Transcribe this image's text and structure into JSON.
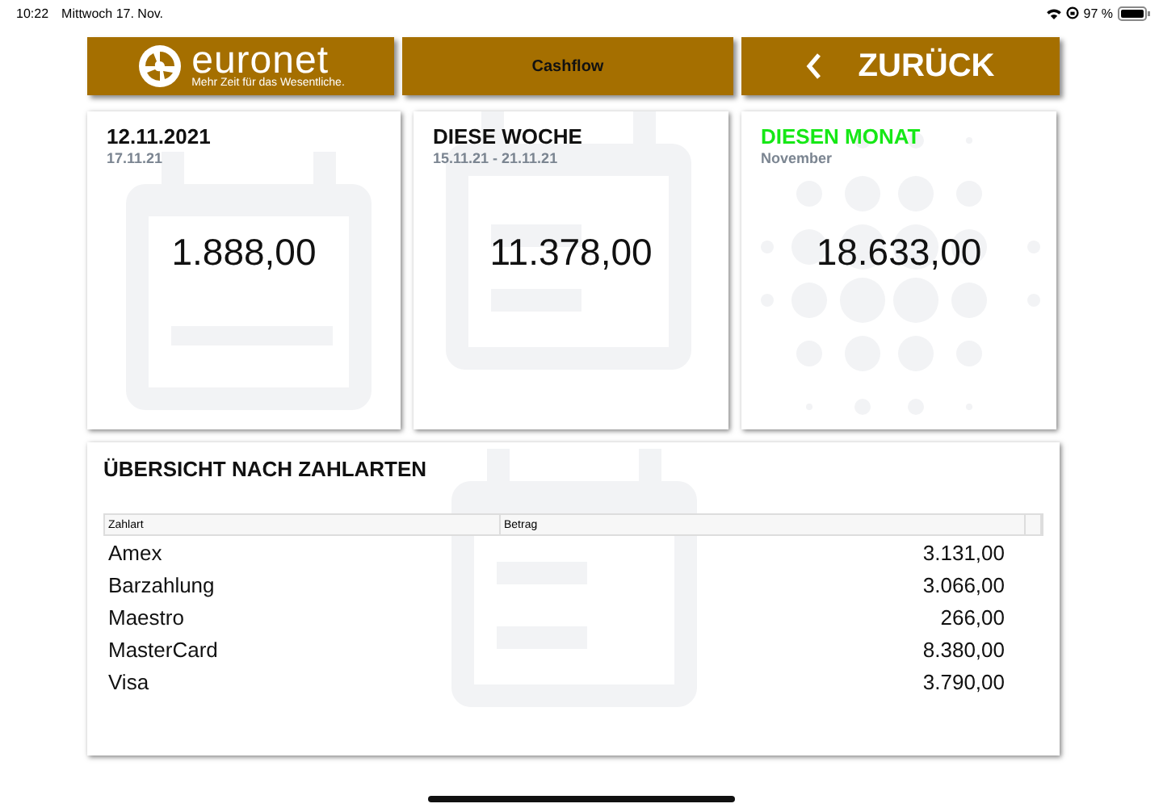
{
  "status_bar": {
    "time": "10:22",
    "date": "Mittwoch 17. Nov.",
    "battery": "97 %"
  },
  "header": {
    "logo_name": "euronet",
    "logo_tagline": "Mehr Zeit für das Wesentliche.",
    "title": "Cashflow",
    "back": "ZURÜCK"
  },
  "cards": [
    {
      "kind": "day",
      "title": "12.11.2021",
      "subtitle": "17.11.21",
      "amount": "1.888,00",
      "highlighted": false
    },
    {
      "kind": "week",
      "title": "DIESE WOCHE",
      "subtitle": "15.11.21 - 21.11.21",
      "amount": "11.378,00",
      "highlighted": false
    },
    {
      "kind": "month",
      "title": "DIESEN MONAT",
      "subtitle": "November",
      "amount": "18.633,00",
      "highlighted": true
    }
  ],
  "overview": {
    "title": "ÜBERSICHT NACH ZAHLARTEN",
    "columns": [
      "Zahlart",
      "Betrag"
    ],
    "rows": [
      {
        "method": "Amex",
        "amount": "3.131,00"
      },
      {
        "method": "Barzahlung",
        "amount": "3.066,00"
      },
      {
        "method": "Maestro",
        "amount": "266,00"
      },
      {
        "method": "MasterCard",
        "amount": "8.380,00"
      },
      {
        "method": "Visa",
        "amount": "3.790,00"
      }
    ]
  }
}
